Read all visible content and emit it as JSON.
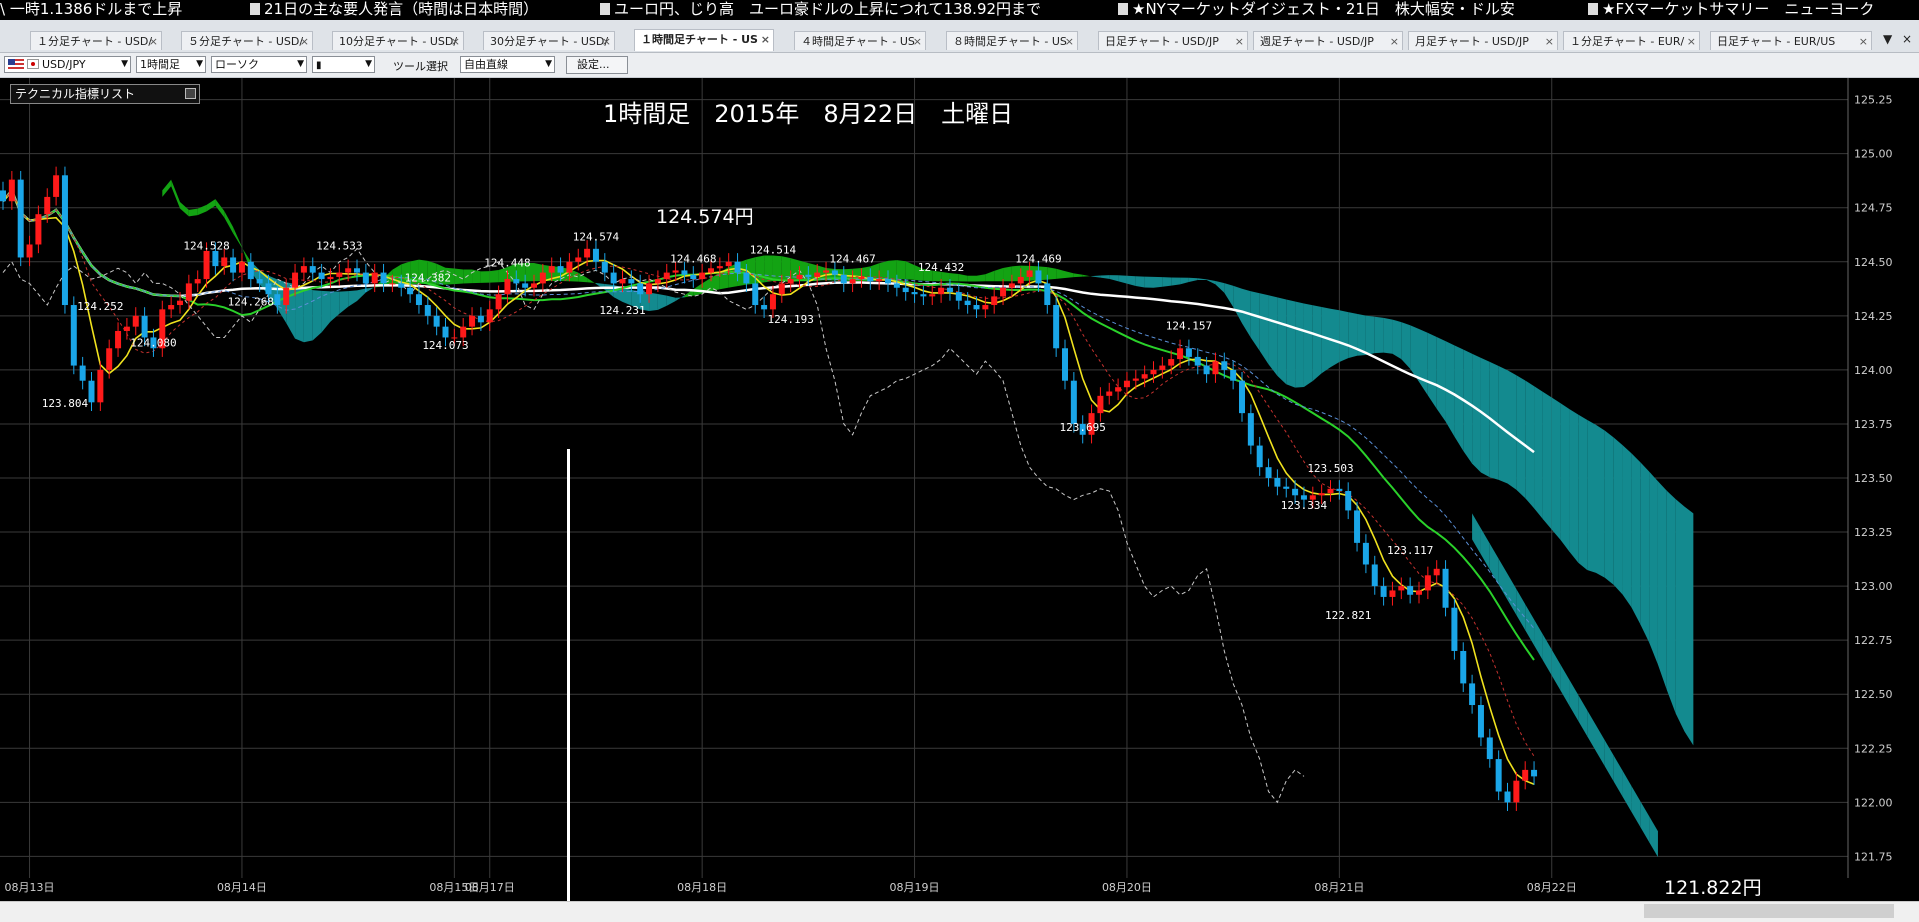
{
  "ticker": {
    "items": [
      "\\  一時1.1386ドルまで上昇",
      "21日の主な要人発言（時間は日本時間）",
      "ユーロ円、じり高　ユーロ豪ドルの上昇につれて138.92円まで",
      "★NYマーケットダイジェスト・21日　株大幅安・ドル安",
      "★FXマーケットサマリー　ニューヨーク"
    ]
  },
  "tabs": [
    {
      "label": "１分足チャート - USD/"
    },
    {
      "label": "５分足チャート - USD/"
    },
    {
      "label": "10分足チャート - USD/"
    },
    {
      "label": "30分足チャート - USD/"
    },
    {
      "label": "１時間足チャート - US",
      "active": true
    },
    {
      "label": "４時間足チャート - US"
    },
    {
      "label": "８時間足チャート - US"
    },
    {
      "label": "日足チャート - USD/JP"
    },
    {
      "label": "週足チャート - USD/JP"
    },
    {
      "label": "月足チャート - USD/JP"
    },
    {
      "label": "１分足チャート - EUR/"
    },
    {
      "label": "日足チャート - EUR/US"
    }
  ],
  "toolbar": {
    "symbol": "USD/JPY",
    "timeframe": "1時間足",
    "chart_style": "ローソク",
    "tool_label": "ツール選択",
    "tool_value": "自由直線",
    "settings": "設定..."
  },
  "indicator_list": "テクニカル指標リスト",
  "colors": {
    "background": "#000000",
    "up": "#ff1a1a",
    "down": "#1aa6e8",
    "cloud_teal": "#138a8f",
    "cloud_green": "#13a313",
    "sma_white": "#ffffff",
    "ema_green": "#2ad12a",
    "line_yellow": "#f0e21e",
    "kijun_red": "#c3312e",
    "chikou_gray": "#c8c8c8",
    "grid": "#3a3a3a",
    "axis_text": "#cfcfcf"
  },
  "chart_data": {
    "type": "candlestick",
    "title": "1時間足　2015年　8月22日　土曜日",
    "symbol": "USD/JPY",
    "ylim": [
      121.65,
      125.35
    ],
    "y_ticks": [
      125.25,
      125.0,
      124.75,
      124.5,
      124.25,
      124.0,
      123.75,
      123.5,
      123.25,
      123.0,
      122.75,
      122.5,
      122.25,
      122.0,
      121.75
    ],
    "x_ticks": [
      {
        "label": "08月13日",
        "i": 3
      },
      {
        "label": "08月14日",
        "i": 27
      },
      {
        "label": "08月15日",
        "i": 51
      },
      {
        "label": "08月17日",
        "i": 55
      },
      {
        "label": "08月18日",
        "i": 79
      },
      {
        "label": "08月19日",
        "i": 103
      },
      {
        "label": "08月20日",
        "i": 127
      },
      {
        "label": "08月21日",
        "i": 151
      },
      {
        "label": "08月22日",
        "i": 175
      }
    ],
    "candles_close": [
      124.78,
      124.88,
      124.52,
      124.58,
      124.72,
      124.8,
      124.9,
      124.3,
      124.02,
      123.95,
      123.85,
      124.0,
      124.1,
      124.18,
      124.2,
      124.25,
      124.15,
      124.1,
      124.28,
      124.3,
      124.32,
      124.4,
      124.42,
      124.55,
      124.48,
      124.52,
      124.45,
      124.5,
      124.42,
      124.4,
      124.35,
      124.3,
      124.38,
      124.45,
      124.48,
      124.45,
      124.42,
      124.43,
      124.45,
      124.47,
      124.45,
      124.4,
      124.45,
      124.4,
      124.4,
      124.38,
      124.35,
      124.3,
      124.25,
      124.2,
      124.15,
      124.15,
      124.2,
      124.25,
      124.22,
      124.28,
      124.35,
      124.42,
      124.4,
      124.38,
      124.4,
      124.45,
      124.48,
      124.45,
      124.5,
      124.52,
      124.56,
      124.5,
      124.45,
      124.4,
      124.42,
      124.4,
      124.35,
      124.4,
      124.42,
      124.45,
      124.46,
      124.44,
      124.42,
      124.45,
      124.47,
      124.48,
      124.5,
      124.45,
      124.4,
      124.3,
      124.28,
      124.35,
      124.4,
      124.42,
      124.44,
      124.43,
      124.45,
      124.46,
      124.44,
      124.4,
      124.42,
      124.43,
      124.41,
      124.42,
      124.4,
      124.38,
      124.36,
      124.35,
      124.34,
      124.35,
      124.38,
      124.36,
      124.32,
      124.3,
      124.28,
      124.3,
      124.34,
      124.38,
      124.4,
      124.43,
      124.46,
      124.4,
      124.3,
      124.1,
      123.95,
      123.75,
      123.7,
      123.8,
      123.88,
      123.9,
      123.92,
      123.95,
      123.96,
      123.98,
      124.0,
      124.02,
      124.05,
      124.1,
      124.06,
      124.02,
      123.98,
      124.04,
      124.0,
      123.95,
      123.8,
      123.65,
      123.55,
      123.5,
      123.46,
      123.45,
      123.42,
      123.4,
      123.42,
      123.43,
      123.45,
      123.44,
      123.35,
      123.2,
      123.1,
      123.0,
      122.95,
      122.98,
      123.0,
      122.96,
      122.98,
      123.05,
      123.08,
      122.9,
      122.7,
      122.55,
      122.45,
      122.3,
      122.2,
      122.05,
      122.0,
      122.1,
      122.15,
      122.12
    ],
    "annotations": [
      {
        "label": "123.804",
        "i": 7,
        "price": 123.8
      },
      {
        "label": "124.252",
        "i": 11,
        "price": 124.25
      },
      {
        "label": "124.080",
        "i": 17,
        "price": 124.08
      },
      {
        "label": "124.528",
        "i": 23,
        "price": 124.53
      },
      {
        "label": "124.268",
        "i": 28,
        "price": 124.27
      },
      {
        "label": "124.533",
        "i": 38,
        "price": 124.53
      },
      {
        "label": "124.382",
        "i": 48,
        "price": 124.38
      },
      {
        "label": "124.073",
        "i": 50,
        "price": 124.07
      },
      {
        "label": "124.448",
        "i": 57,
        "price": 124.45
      },
      {
        "label": "124.574",
        "i": 67,
        "price": 124.57
      },
      {
        "label": "124.231",
        "i": 70,
        "price": 124.23
      },
      {
        "label": "124.468",
        "i": 78,
        "price": 124.47
      },
      {
        "label": "124.514",
        "i": 87,
        "price": 124.51
      },
      {
        "label": "124.193",
        "i": 89,
        "price": 124.19
      },
      {
        "label": "124.467",
        "i": 96,
        "price": 124.47
      },
      {
        "label": "124.432",
        "i": 106,
        "price": 124.43
      },
      {
        "label": "124.469",
        "i": 117,
        "price": 124.47
      },
      {
        "label": "123.695",
        "i": 122,
        "price": 123.69
      },
      {
        "label": "124.157",
        "i": 134,
        "price": 124.16
      },
      {
        "label": "123.503",
        "i": 150,
        "price": 123.5
      },
      {
        "label": "123.334",
        "i": 147,
        "price": 123.33
      },
      {
        "label": "123.117",
        "i": 159,
        "price": 123.12
      },
      {
        "label": "122.821",
        "i": 152,
        "price": 122.82
      }
    ],
    "high_label": "124.574円",
    "last_label": "121.822円"
  }
}
